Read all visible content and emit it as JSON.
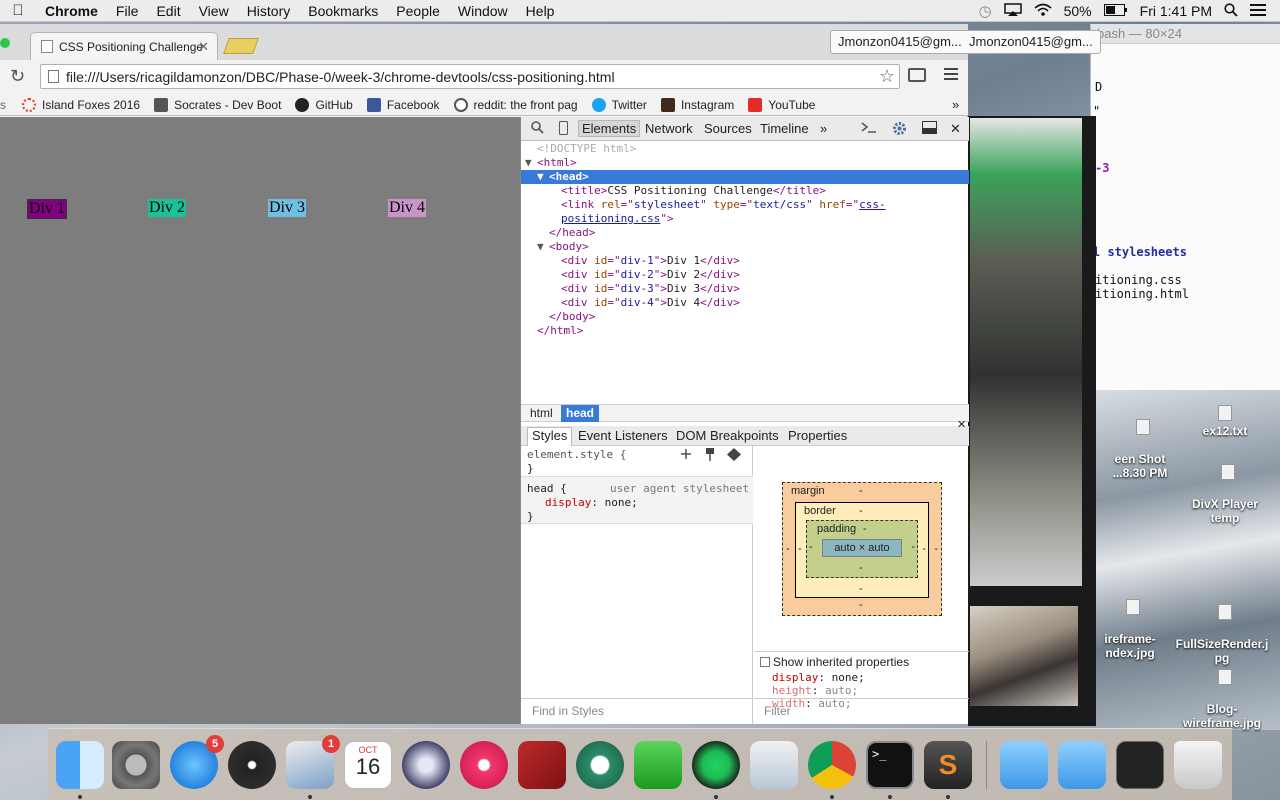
{
  "menubar": {
    "app": "Chrome",
    "items": [
      "File",
      "Edit",
      "View",
      "History",
      "Bookmarks",
      "People",
      "Window",
      "Help"
    ],
    "battery": "50%",
    "clock": "Fri 1:41 PM"
  },
  "terminal": {
    "title": "bash — 80×24",
    "lines": [
      "D",
      "\"",
      "-3",
      "l stylesheets",
      "itioning.css",
      "itioning.html"
    ]
  },
  "desktop": {
    "items": [
      {
        "label": "een Shot\n...8.30 PM"
      },
      {
        "label": "ex12.txt"
      },
      {
        "label": "DivX Player\ntemp"
      },
      {
        "label": "ireframe-\nndex.jpg"
      },
      {
        "label": "FullSizeRender.j\npg"
      },
      {
        "label": "Blog-\nwireframe.jpg"
      }
    ]
  },
  "browser": {
    "tab_title": "CSS Positioning Challenge",
    "profile_1": "Jmonzon0415@gm...",
    "profile_2": "Jmonzon0415@gm...",
    "url": "file:///Users/ricagildamonzon/DBC/Phase-0/week-3/chrome-devtools/css-positioning.html",
    "bookmarks": [
      {
        "label": "Island Foxes 2016",
        "color": "#d9402b"
      },
      {
        "label": "Socrates - Dev Boot",
        "color": "#555555"
      },
      {
        "label": "GitHub",
        "color": "#222222"
      },
      {
        "label": "Facebook",
        "color": "#3b5998"
      },
      {
        "label": "reddit: the front pag",
        "color": "#ff4500"
      },
      {
        "label": "Twitter",
        "color": "#1da1f2"
      },
      {
        "label": "Instagram",
        "color": "#3f2a1d"
      },
      {
        "label": "YouTube",
        "color": "#e52d27"
      }
    ],
    "bookmarks_more": "»",
    "secondary_twitter": "Twitter"
  },
  "page": {
    "divs": [
      {
        "label": "Div 1",
        "bg": "#800080",
        "left": "27"
      },
      {
        "label": "Div 2",
        "bg": "#18c39a",
        "left": "148"
      },
      {
        "label": "Div 3",
        "bg": "#6fc0e0",
        "left": "268"
      },
      {
        "label": "Div 4",
        "bg": "#c994c7",
        "left": "388"
      }
    ]
  },
  "devtools": {
    "tabs": [
      "Elements",
      "Network",
      "Sources",
      "Timeline"
    ],
    "more": "»",
    "dom": {
      "doctype": "<!DOCTYPE html>",
      "html_open": "<html>",
      "head_open": "<head>",
      "title_line": "CSS Positioning Challenge",
      "link_rel": "stylesheet",
      "link_type": "text/css",
      "link_href_1": "css-",
      "link_href_2": "positioning.css",
      "head_close": "</head>",
      "body_open": "<body>",
      "divs": [
        {
          "id": "div-1",
          "text": "Div 1"
        },
        {
          "id": "div-2",
          "text": "Div 2"
        },
        {
          "id": "div-3",
          "text": "Div 3"
        },
        {
          "id": "div-4",
          "text": "Div 4"
        }
      ],
      "body_close": "</body>",
      "html_close": "</html>"
    },
    "crumbs": [
      "html",
      "head"
    ],
    "sub_tabs": [
      "Styles",
      "Event Listeners",
      "DOM Breakpoints",
      "Properties"
    ],
    "styles": {
      "element_style": "element.style {",
      "close_brace": "}",
      "head_selector": "head {",
      "ua": "user agent stylesheet",
      "prop": "display",
      "value": "none;",
      "find": "Find in Styles"
    },
    "boxmodel": {
      "margin": "margin",
      "border": "border",
      "padding": "padding",
      "dash": "-",
      "content": "auto × auto"
    },
    "computed": {
      "show_inherited": "Show inherited properties",
      "props": [
        {
          "k": "display",
          "v": "none;",
          "dim": false
        },
        {
          "k": "height",
          "v": "auto;",
          "dim": true
        },
        {
          "k": "width",
          "v": "auto;",
          "dim": true
        }
      ],
      "filter": "Filter"
    }
  },
  "dock": {
    "mail_badge": "5",
    "contacts_badge": "1",
    "calendar_month": "OCT",
    "calendar_day": "16"
  }
}
